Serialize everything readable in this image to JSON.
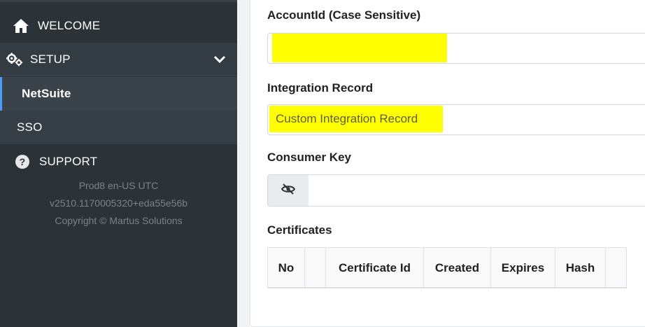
{
  "sidebar": {
    "items": [
      {
        "label": "WELCOME",
        "icon": "home-icon"
      },
      {
        "label": "SETUP",
        "icon": "gears-icon",
        "expanded": true
      },
      {
        "label": "NetSuite",
        "active": true
      },
      {
        "label": "SSO"
      },
      {
        "label": "SUPPORT",
        "icon": "question-circle-icon"
      }
    ],
    "info": {
      "env": "Prod8 en-US UTC",
      "version": "v2510.1170005320+eda55e56b",
      "copyright": "Copyright © Martus Solutions"
    }
  },
  "form": {
    "account_label": "AccountId (Case Sensitive)",
    "account_value": "",
    "integration_label": "Integration Record",
    "integration_value": "Custom Integration Record",
    "consumer_label": "Consumer Key",
    "consumer_value": "",
    "certificates_label": "Certificates"
  },
  "certificates_table": {
    "columns": [
      "No",
      "",
      "Certificate Id",
      "Created",
      "Expires",
      "Hash",
      ""
    ]
  },
  "colors": {
    "sidebar_bg": "#2b3238",
    "active_accent": "#4a9cff",
    "highlight": "#ffff00"
  }
}
